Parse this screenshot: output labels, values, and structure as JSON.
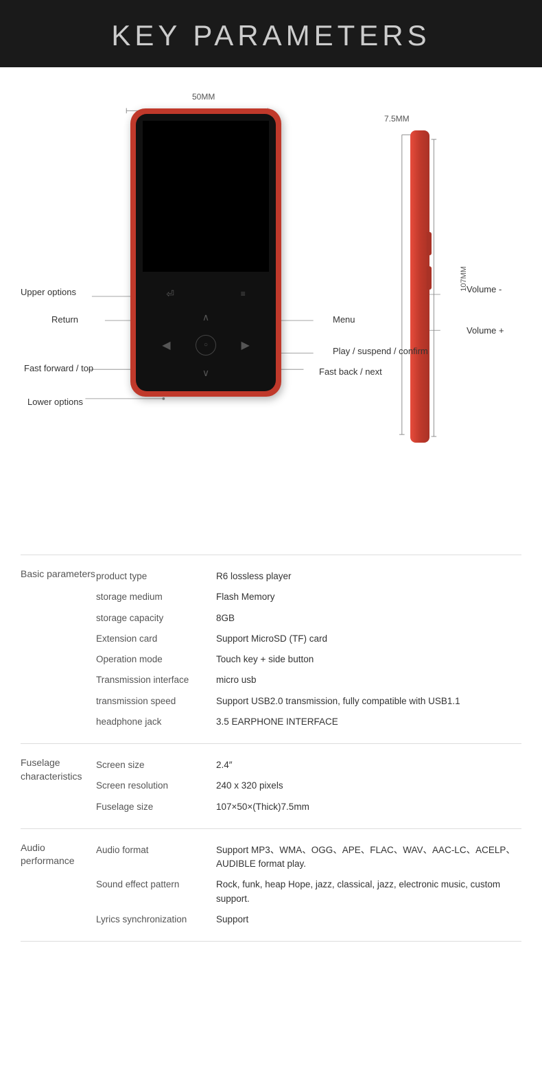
{
  "header": {
    "title": "KEY PARAMETERS"
  },
  "diagram": {
    "dimension_width": "50MM",
    "dimension_height": "107MM",
    "dimension_thickness": "7.5MM",
    "labels": {
      "upper_options": "Upper options",
      "return": "Return",
      "menu": "Menu",
      "play_suspend": "Play / suspend /\nconfirm",
      "fast_forward": "Fast forward\n/ top",
      "fast_back": "Fast back / next",
      "lower_options": "Lower options",
      "volume_minus": "Volume -",
      "volume_plus": "Volume +"
    }
  },
  "basic_parameters": {
    "category": "Basic\nparameters",
    "rows": [
      {
        "name": "product type",
        "value": "R6 lossless player"
      },
      {
        "name": "storage medium",
        "value": "Flash Memory"
      },
      {
        "name": "storage capacity",
        "value": "8GB"
      },
      {
        "name": "Extension card",
        "value": "Support MicroSD (TF) card"
      },
      {
        "name": "Operation mode",
        "value": "Touch key + side button"
      },
      {
        "name": "Transmission interface",
        "value": "micro usb"
      },
      {
        "name": "transmission speed",
        "value": "Support USB2.0 transmission, fully compatible with USB1.1"
      },
      {
        "name": "headphone jack",
        "value": "3.5 EARPHONE INTERFACE"
      }
    ]
  },
  "fuselage_characteristics": {
    "category": "Fuselage\ncharacteristics",
    "rows": [
      {
        "name": "Screen size",
        "value": "2.4″"
      },
      {
        "name": "Screen resolution",
        "value": "240 x 320 pixels"
      },
      {
        "name": "Fuselage size",
        "value": "107×50×(Thick)7.5mm"
      }
    ]
  },
  "audio_performance": {
    "category": "Audio\nperformance",
    "rows": [
      {
        "name": "Audio format",
        "value": "Support MP3、WMA、OGG、APE、FLAC、WAV、AAC-LC、ACELP、AUDIBLE format play."
      },
      {
        "name": "Sound effect pattern",
        "value": "Rock, funk, heap Hope, jazz, classical, jazz, electronic music, custom support."
      },
      {
        "name": "Lyrics synchronization",
        "value": "Support"
      }
    ]
  }
}
